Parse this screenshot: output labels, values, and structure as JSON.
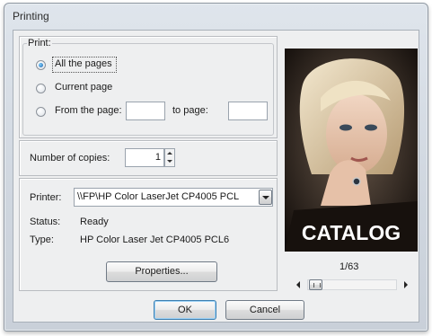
{
  "window": {
    "title": "Printing"
  },
  "print_group": {
    "legend": "Print:",
    "options": [
      {
        "label": "All the pages",
        "selected": true
      },
      {
        "label": "Current page",
        "selected": false
      },
      {
        "label": "From the page:",
        "selected": false
      }
    ],
    "from_value": "",
    "to_label": "to page:",
    "to_value": ""
  },
  "copies": {
    "label": "Number of copies:",
    "value": "1"
  },
  "printer": {
    "label": "Printer:",
    "selected": "\\\\FP\\HP Color LaserJet CP4005 PCL",
    "status_label": "Status:",
    "status_value": "Ready",
    "type_label": "Type:",
    "type_value": "HP Color Laser Jet CP4005 PCL6",
    "properties_label": "Properties..."
  },
  "preview": {
    "overlay_text": "CATALOG",
    "page_indicator": "1/63"
  },
  "buttons": {
    "ok": "OK",
    "cancel": "Cancel"
  },
  "colors": {
    "accent": "#3c7fb1",
    "radio_dot": "#1d5fa8",
    "window_frame": "#cfd6df"
  }
}
